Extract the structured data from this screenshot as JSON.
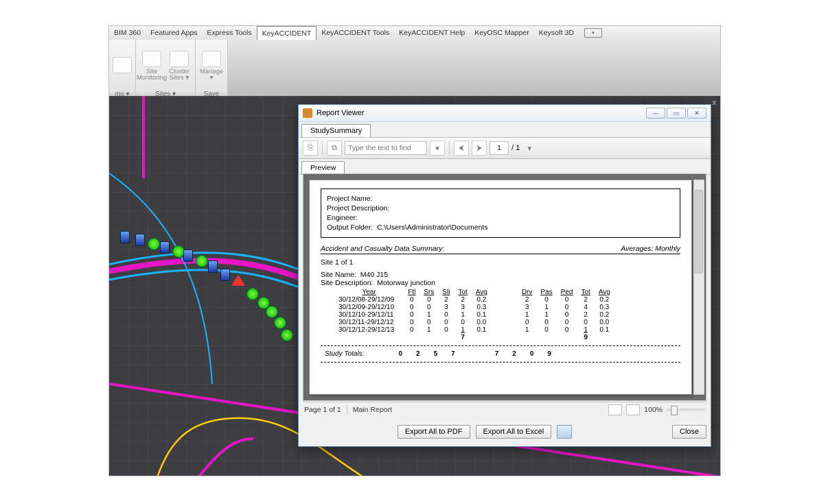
{
  "menubar": {
    "items": [
      "BIM 360",
      "Featured Apps",
      "Express Tools",
      "KeyACCIDENT",
      "KeyACCIDENT Tools",
      "KeyACCIDENT Help",
      "KeyOSC Mapper",
      "Keysoft 3D"
    ],
    "active_index": 3
  },
  "ribbon": {
    "group0_label": "ms ▾",
    "group1": {
      "items": [
        "Site Monitoring",
        "Cluster Sites ▾"
      ],
      "title": "Sites ▾"
    },
    "group2": {
      "items": [
        "Manage ▾"
      ],
      "title": "Save"
    }
  },
  "canvas": {
    "close_label": "x"
  },
  "report_window": {
    "title": "Report Viewer",
    "tabs": {
      "main": "StudySummary"
    },
    "toolbar": {
      "find_placeholder": "Type the text to find",
      "page_current": "1",
      "page_total": "/ 1"
    },
    "subtabs": {
      "preview": "Preview"
    },
    "header": {
      "project_name_label": "Project Name:",
      "project_desc_label": "Project Description:",
      "engineer_label": "Engineer:",
      "output_label": "Output Folder:",
      "output_value": "C:\\Users\\Administrator\\Documents"
    },
    "section": {
      "title": "Accident and Casualty Data Summary:",
      "averages": "Averages: Monthly"
    },
    "site": {
      "count": "Site 1 of 1",
      "name_label": "Site Name:",
      "name": "M40 J15",
      "desc_label": "Site Description:",
      "desc": "Motorway junction"
    },
    "columns_left": [
      "Year",
      "Ftl",
      "Srs",
      "Sli",
      "Tot",
      "Avg"
    ],
    "columns_right": [
      "Drv",
      "Pas",
      "Ped",
      "Tot",
      "Avg"
    ],
    "rows": [
      {
        "year": "30/12/08-29/12/09",
        "l": [
          "0",
          "0",
          "2",
          "2",
          "0.2"
        ],
        "r": [
          "2",
          "0",
          "0",
          "2",
          "0.2"
        ]
      },
      {
        "year": "30/12/09-29/12/10",
        "l": [
          "0",
          "0",
          "3",
          "3",
          "0.3"
        ],
        "r": [
          "3",
          "1",
          "0",
          "4",
          "0.3"
        ]
      },
      {
        "year": "30/12/10-29/12/11",
        "l": [
          "0",
          "1",
          "0",
          "1",
          "0.1"
        ],
        "r": [
          "1",
          "1",
          "0",
          "2",
          "0.2"
        ]
      },
      {
        "year": "30/12/11-29/12/12",
        "l": [
          "0",
          "0",
          "0",
          "0",
          "0.0"
        ],
        "r": [
          "0",
          "0",
          "0",
          "0",
          "0.0"
        ]
      },
      {
        "year": "30/12/12-29/12/13",
        "l": [
          "0",
          "1",
          "0",
          "1",
          "0.1"
        ],
        "r": [
          "1",
          "0",
          "0",
          "1",
          "0.1"
        ]
      }
    ],
    "subtotals": {
      "left": "7",
      "right": "9"
    },
    "study_totals": {
      "label": "Study Totals:",
      "l": [
        "0",
        "2",
        "5",
        "7"
      ],
      "r": [
        "7",
        "2",
        "0",
        "9"
      ]
    },
    "status": {
      "page": "Page 1 of 1",
      "main": "Main Report",
      "zoom": "100%"
    },
    "footer": {
      "pdf": "Export All to PDF",
      "excel": "Export All to Excel",
      "close": "Close"
    }
  }
}
